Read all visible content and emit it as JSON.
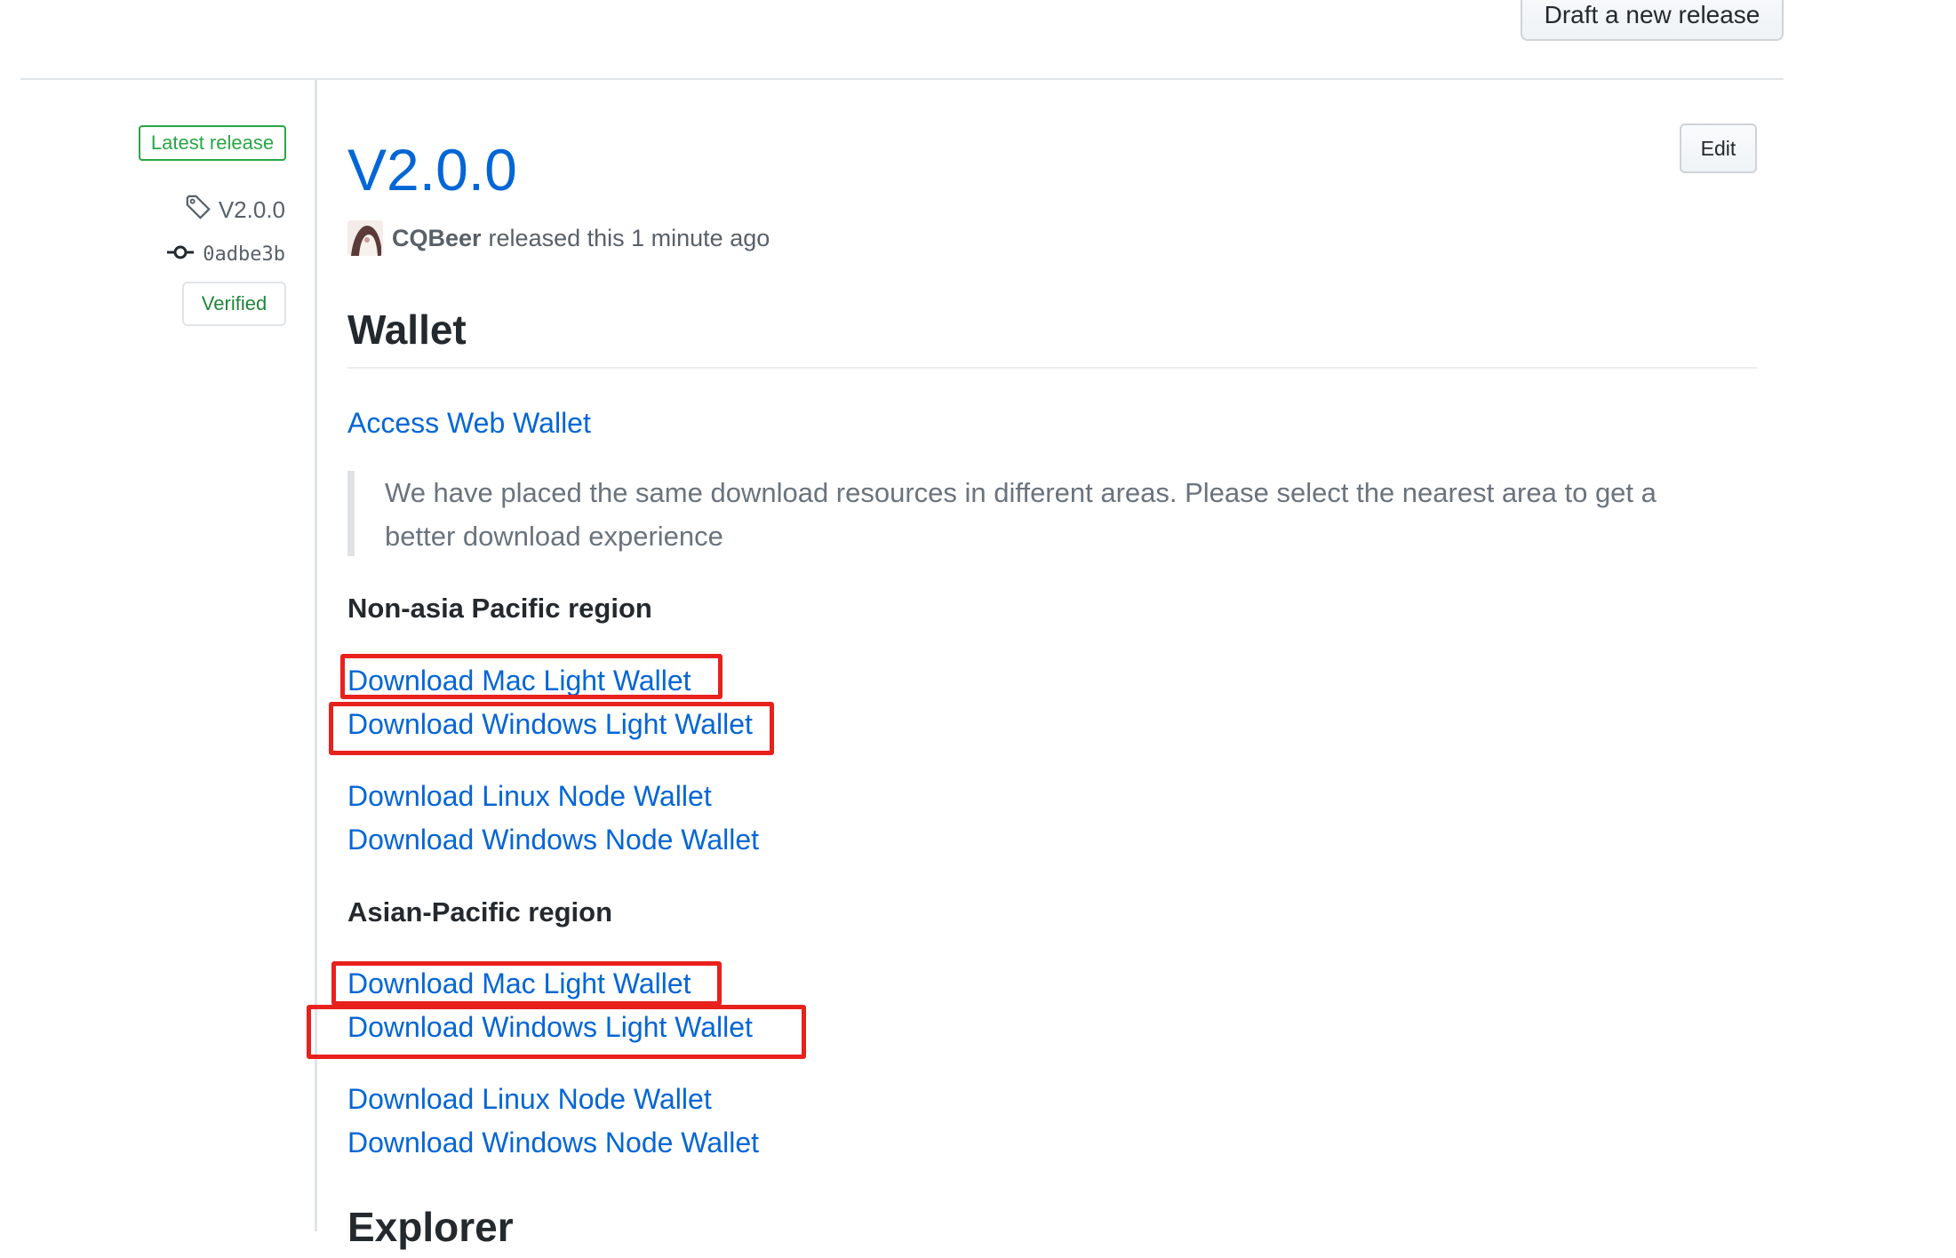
{
  "header": {
    "draft_button": "Draft a new release"
  },
  "meta": {
    "latest_badge": "Latest release",
    "tag": "V2.0.0",
    "commit": "0adbe3b",
    "verified_badge": "Verified"
  },
  "release": {
    "title": "V2.0.0",
    "edit_button": "Edit",
    "author": "CQBeer",
    "released_text": "released this 1 minute ago"
  },
  "sections": {
    "wallet_heading": "Wallet",
    "access_web_wallet": "Access Web Wallet",
    "blockquote": "We have placed the same download resources in different areas. Please select the nearest area to get a better download experience",
    "non_asia_heading": "Non-asia Pacific region",
    "non_asia_links": [
      "Download Mac Light Wallet",
      "Download Windows Light Wallet",
      "Download Linux Node Wallet",
      "Download Windows Node Wallet"
    ],
    "asia_heading": "Asian-Pacific region",
    "asia_links": [
      "Download Mac Light Wallet",
      "Download Windows Light Wallet",
      "Download Linux Node Wallet",
      "Download Windows Node Wallet"
    ],
    "explorer_heading": "Explorer"
  },
  "colors": {
    "link": "#0366d6",
    "annotation": "#e8211c",
    "latest": "#28a745",
    "verified": "#22863a"
  }
}
